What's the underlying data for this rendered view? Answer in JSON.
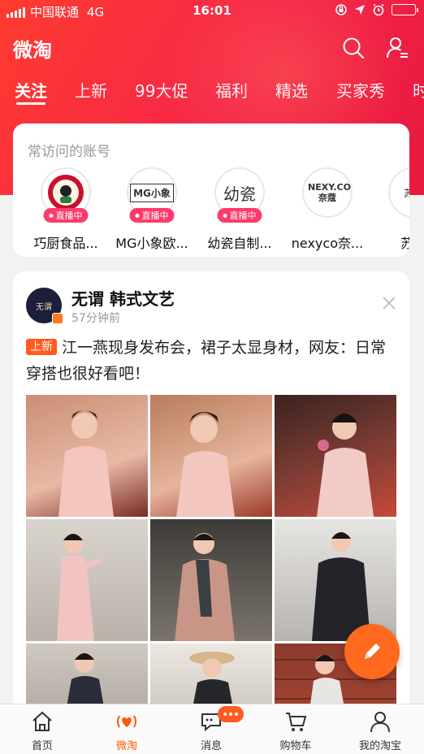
{
  "status_bar": {
    "carrier": "中国联通",
    "network": "4G",
    "time": "16:01"
  },
  "header": {
    "title": "微淘"
  },
  "tabs": [
    {
      "label": "关注",
      "active": true
    },
    {
      "label": "上新"
    },
    {
      "label": "99大促"
    },
    {
      "label": "福利"
    },
    {
      "label": "精选"
    },
    {
      "label": "买家秀"
    },
    {
      "label": "时"
    }
  ],
  "frequent": {
    "title": "常访问的账号",
    "live_label": "直播中",
    "accounts": [
      {
        "name": "巧厨食品...",
        "logo_text": "",
        "live": true
      },
      {
        "name": "MG小象欧...",
        "logo_text": "MG小象",
        "live": true
      },
      {
        "name": "幼瓷自制...",
        "logo_text": "幼瓷",
        "live": true
      },
      {
        "name": "nexyco奈...",
        "logo_text": "NEXY.CO 奈蔻",
        "live": false
      },
      {
        "name": "苏宁",
        "logo_text": "苏宁",
        "live": false
      }
    ]
  },
  "post": {
    "author": "无谓 韩式文艺",
    "avatar_text": "无谓",
    "time": "57分钟前",
    "tag": "上新",
    "text": "江一燕现身发布会，裙子太显身材，网友：日常穿搭也很好看吧！"
  },
  "bottom_nav": [
    {
      "label": "首页",
      "icon": "home-icon"
    },
    {
      "label": "微淘",
      "icon": "weitao-icon",
      "active": true
    },
    {
      "label": "消息",
      "icon": "message-icon"
    },
    {
      "label": "购物车",
      "icon": "cart-icon"
    },
    {
      "label": "我的淘宝",
      "icon": "profile-icon"
    }
  ],
  "colors": {
    "brand_red": "#ff3b2f",
    "accent_orange": "#ff5a00",
    "live_pink": "#ff3b6b"
  }
}
